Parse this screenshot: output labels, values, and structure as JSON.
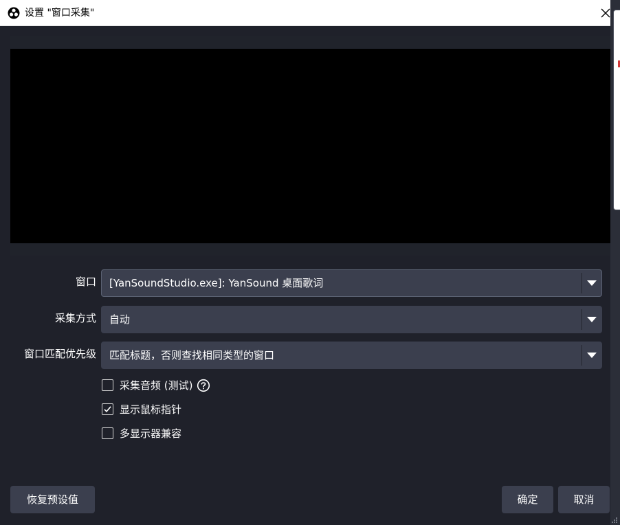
{
  "window": {
    "title": "设置 \"窗口采集\""
  },
  "form": {
    "window_label": "窗口",
    "window_value": "[YanSoundStudio.exe]: YanSound 桌面歌词",
    "capture_method_label": "采集方式",
    "capture_method_value": "自动",
    "match_priority_label": "窗口匹配优先级",
    "match_priority_value": "匹配标题，否则查找相同类型的窗口"
  },
  "checkboxes": [
    {
      "label": "采集音频 (测试)",
      "checked": false
    },
    {
      "label": "显示鼠标指针",
      "checked": true
    },
    {
      "label": "多显示器兼容",
      "checked": false
    }
  ],
  "buttons": {
    "defaults": "恢复预设值",
    "ok": "确定",
    "cancel": "取消"
  },
  "colors": {
    "background": "#1f212a",
    "control": "#3b3f4e",
    "preview": "#000000"
  }
}
